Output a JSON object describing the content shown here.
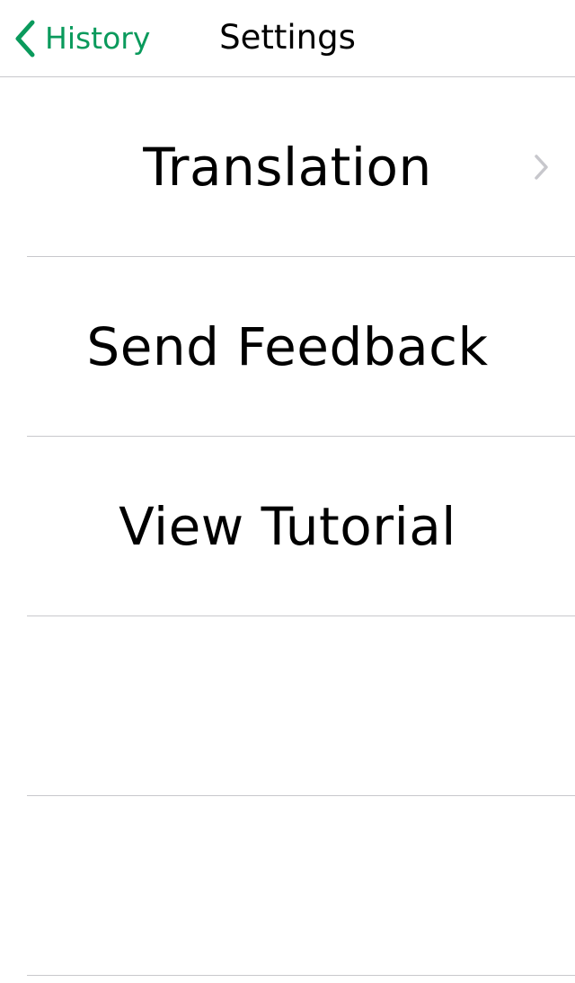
{
  "colors": {
    "accent": "#0a9a5c",
    "separator": "#c8c8cc",
    "chevron": "#c7c7cc"
  },
  "navbar": {
    "back_label": "History",
    "back_icon": "chevron-left-icon",
    "title": "Settings"
  },
  "menu": {
    "items": [
      {
        "label": "Translation",
        "has_chevron": true
      },
      {
        "label": "Send Feedback",
        "has_chevron": false
      },
      {
        "label": "View Tutorial",
        "has_chevron": false
      },
      {
        "label": "",
        "has_chevron": false
      },
      {
        "label": "",
        "has_chevron": false
      }
    ]
  }
}
